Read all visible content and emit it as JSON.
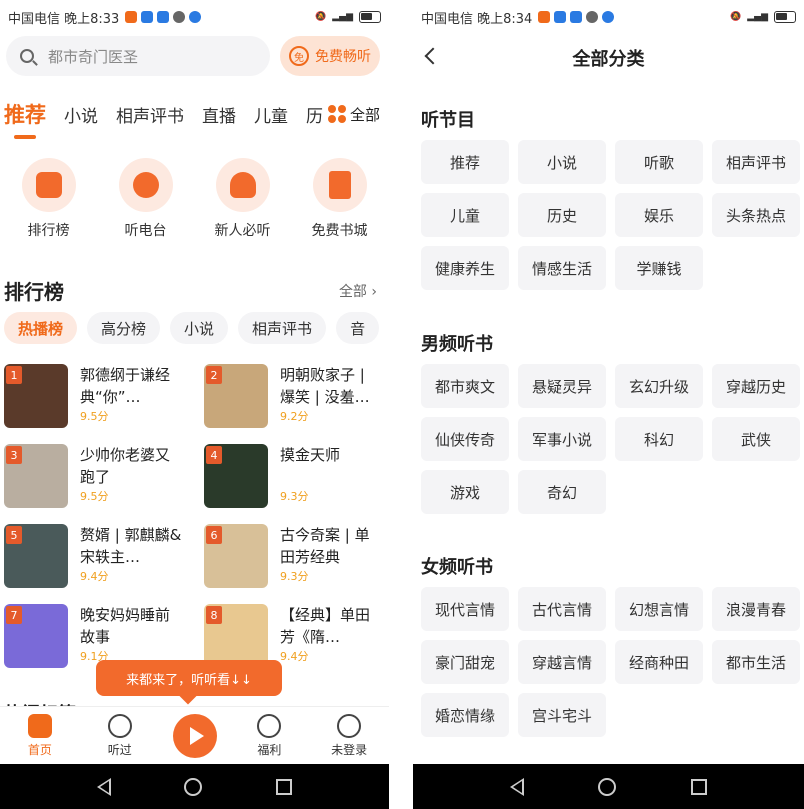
{
  "left": {
    "status": {
      "carrier": "中国电信 晚上8:33"
    },
    "search": {
      "placeholder": "都市奇门医圣",
      "free_label": "免费畅听",
      "free_icon_text": "免"
    },
    "tabs": [
      "推荐",
      "小说",
      "相声评书",
      "直播",
      "儿童",
      "历"
    ],
    "tab_all_label": "全部",
    "quick": [
      {
        "label": "排行榜",
        "icon": "trophy-icon"
      },
      {
        "label": "听电台",
        "icon": "radio-icon"
      },
      {
        "label": "新人必听",
        "icon": "headphones-icon"
      },
      {
        "label": "免费书城",
        "icon": "book-icon"
      }
    ],
    "rank": {
      "title": "排行榜",
      "all_label": "全部 ›",
      "chips": [
        "热播榜",
        "高分榜",
        "小说",
        "相声评书",
        "音"
      ],
      "books": [
        {
          "rank": "1",
          "title": "郭德纲于谦经典“你”…",
          "score": "9.5分",
          "color": "#5a3a2a"
        },
        {
          "rank": "2",
          "title": "明朝败家子 | 爆笑 | 没羞…",
          "score": "9.2分",
          "color": "#c8a77a"
        },
        {
          "rank": "3",
          "title": "少帅你老婆又跑了",
          "score": "9.5分",
          "color": "#b9aea0"
        },
        {
          "rank": "4",
          "title": "摸金天师",
          "score": "9.3分",
          "color": "#2a3a2a"
        },
        {
          "rank": "5",
          "title": "赘婿 | 郭麒麟&宋轶主…",
          "score": "9.4分",
          "color": "#4a5a5a"
        },
        {
          "rank": "6",
          "title": "古今奇案 | 单田芳经典",
          "score": "9.3分",
          "color": "#d8c098"
        },
        {
          "rank": "7",
          "title": "晚安妈妈睡前故事",
          "score": "9.1分",
          "color": "#7a6ad8"
        },
        {
          "rank": "8",
          "title": "【经典】单田芳《隋…",
          "score": "9.4分",
          "color": "#e8c890"
        }
      ]
    },
    "toast": "来都来了，听听看↓↓",
    "partial_heading": "热门标签",
    "bottom_nav": [
      {
        "label": "首页",
        "icon": "home-icon",
        "active": true
      },
      {
        "label": "听过",
        "icon": "history-icon",
        "active": false
      },
      {
        "label": "",
        "icon": "play-icon",
        "active": false
      },
      {
        "label": "福利",
        "icon": "money-bag-icon",
        "active": false
      },
      {
        "label": "未登录",
        "icon": "user-icon",
        "active": false
      }
    ]
  },
  "right": {
    "status": {
      "carrier": "中国电信 晚上8:34"
    },
    "title": "全部分类",
    "sections": [
      {
        "title": "听节目",
        "items": [
          "推荐",
          "小说",
          "听歌",
          "相声评书",
          "儿童",
          "历史",
          "娱乐",
          "头条热点",
          "健康养生",
          "情感生活",
          "学赚钱"
        ]
      },
      {
        "title": "男频听书",
        "items": [
          "都市爽文",
          "悬疑灵异",
          "玄幻升级",
          "穿越历史",
          "仙侠传奇",
          "军事小说",
          "科幻",
          "武侠",
          "游戏",
          "奇幻"
        ]
      },
      {
        "title": "女频听书",
        "items": [
          "现代言情",
          "古代言情",
          "幻想言情",
          "浪漫青春",
          "豪门甜宠",
          "穿越言情",
          "经商种田",
          "都市生活",
          "婚恋情缘",
          "宫斗宅斗"
        ]
      }
    ]
  },
  "colors": {
    "accent": "#f06a1b",
    "chip_bg": "#f4f4f6"
  }
}
